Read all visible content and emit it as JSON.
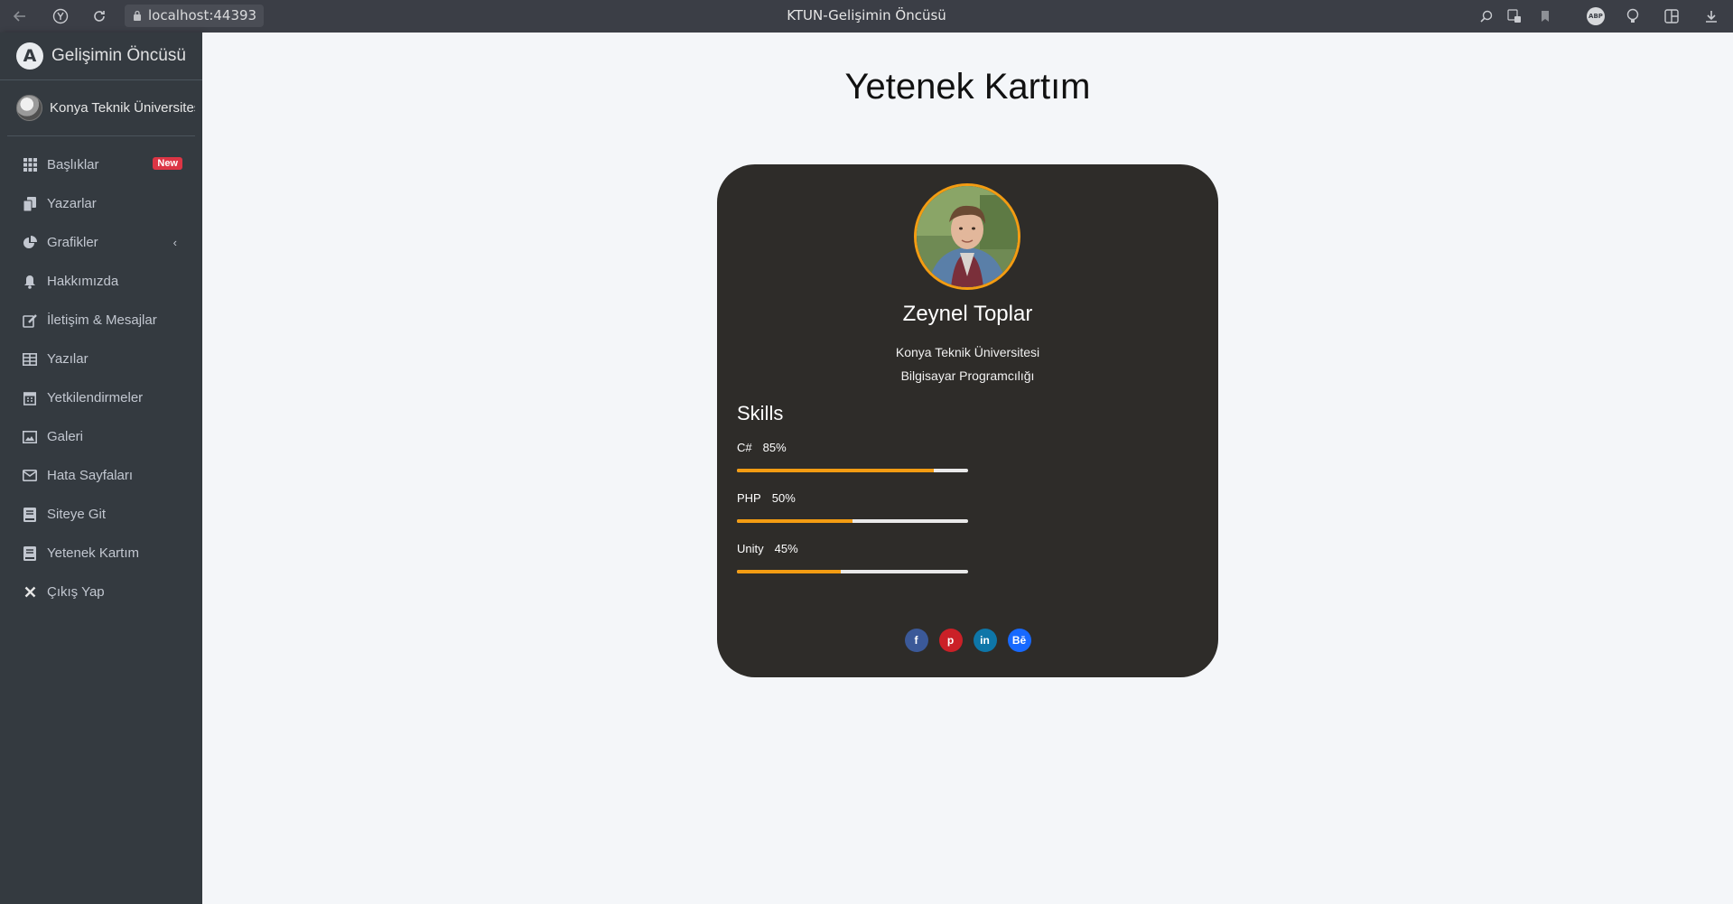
{
  "browser": {
    "url": "localhost:44393",
    "tab_title": "KTUN-Gelişimin Öncüsü",
    "extension_abp": "ABP"
  },
  "sidebar": {
    "brand_letter": "A",
    "brand": "Gelişimin Öncüsü",
    "user": "Konya Teknik Üniversitesi",
    "items": [
      {
        "label": "Başlıklar",
        "icon": "grid-icon",
        "badge": "New"
      },
      {
        "label": "Yazarlar",
        "icon": "copy-icon"
      },
      {
        "label": "Grafikler",
        "icon": "pie-chart-icon",
        "chevron": "‹"
      },
      {
        "label": "Hakkımızda",
        "icon": "bell-icon"
      },
      {
        "label": "İletişim & Mesajlar",
        "icon": "edit-icon"
      },
      {
        "label": "Yazılar",
        "icon": "table-icon"
      },
      {
        "label": "Yetkilendirmeler",
        "icon": "calendar-icon"
      },
      {
        "label": "Galeri",
        "icon": "image-icon"
      },
      {
        "label": "Hata Sayfaları",
        "icon": "envelope-icon"
      },
      {
        "label": "Siteye Git",
        "icon": "book-icon"
      },
      {
        "label": "Yetenek Kartım",
        "icon": "book-icon"
      },
      {
        "label": "Çıkış Yap",
        "icon": "close-icon"
      }
    ]
  },
  "main": {
    "title": "Yetenek Kartım"
  },
  "card": {
    "name": "Zeynel Toplar",
    "university": "Konya Teknik Üniversitesi",
    "department": "Bilgisayar Programcılığı",
    "skills_title": "Skills",
    "skills": [
      {
        "name": "C#",
        "percent_label": "85%",
        "value": 85
      },
      {
        "name": "PHP",
        "percent_label": "50%",
        "value": 50
      },
      {
        "name": "Unity",
        "percent_label": "45%",
        "value": 45
      }
    ],
    "socials": [
      {
        "name": "facebook",
        "glyph": "f",
        "color": "#3b5998"
      },
      {
        "name": "pinterest",
        "glyph": "p",
        "color": "#cb2027"
      },
      {
        "name": "linkedin",
        "glyph": "in",
        "color": "#0e76a8"
      },
      {
        "name": "behance",
        "glyph": "Bē",
        "color": "#1769ff"
      }
    ]
  },
  "colors": {
    "sidebar_bg": "#343a40",
    "card_bg": "#2e2c29",
    "accent": "#f39c12",
    "badge": "#dc3545"
  }
}
